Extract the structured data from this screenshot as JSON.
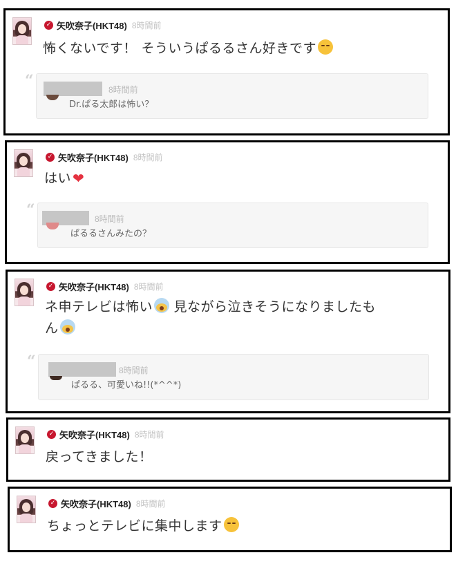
{
  "author": {
    "name": "矢吹奈子(HKT48)",
    "avatar": "avatar-photo",
    "badge": "verified-check-icon",
    "accent": "#c7172f"
  },
  "comments": [
    {
      "time": "8時間前",
      "text": "怖くないです！ そういうぱるるさん好きです",
      "emoji": "blush-face-emoji",
      "reply": {
        "time": "8時間前",
        "text": "Dr.ぱる太郎は怖い？"
      }
    },
    {
      "time": "8時間前",
      "text": "はい",
      "emoji": "red-heart-emoji",
      "reply": {
        "time": "8時間前",
        "text": "ぱるるさんみたの？"
      }
    },
    {
      "time": "8時間前",
      "text_a": "ネ申テレビは怖い",
      "text_b": " 見ながら泣きそうになりましたも",
      "text_c": "ん",
      "emoji": "screaming-face-emoji",
      "reply": {
        "time": "8時間前",
        "text": "ぱるる、可愛いね!!(*^^*)"
      }
    },
    {
      "time": "8時間前",
      "text": "戻ってきました！"
    },
    {
      "time": "8時間前",
      "text": "ちょっとテレビに集中します",
      "emoji": "blush-face-emoji"
    }
  ]
}
